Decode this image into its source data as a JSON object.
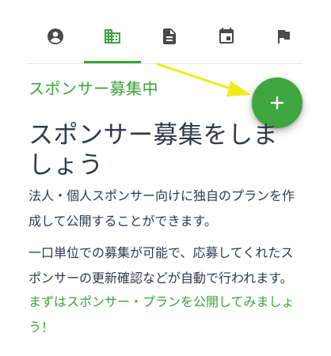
{
  "tabs": [
    {
      "icon": "account-circle-icon",
      "active": false
    },
    {
      "icon": "business-icon",
      "active": true
    },
    {
      "icon": "document-icon",
      "active": false
    },
    {
      "icon": "calendar-icon",
      "active": false
    },
    {
      "icon": "flag-icon",
      "active": false
    }
  ],
  "section": {
    "heading": "スポンサー募集中"
  },
  "fab": {
    "icon": "plus-icon"
  },
  "content": {
    "title": "スポンサー募集をしましょう",
    "paragraph1": "法人・個人スポンサー向けに独自のプランを作成して公開することができます。",
    "paragraph2": "一口単位での募集が可能で、応募してくれたスポンサーの更新確認などが自動で行われます。",
    "cta": "まずはスポンサー・プランを公開してみましょう！"
  },
  "colors": {
    "accent": "#3aa33a",
    "text": "#2f3a48",
    "icon_inactive": "#4a4a4a",
    "annotation_arrow": "#f2ea1c"
  }
}
